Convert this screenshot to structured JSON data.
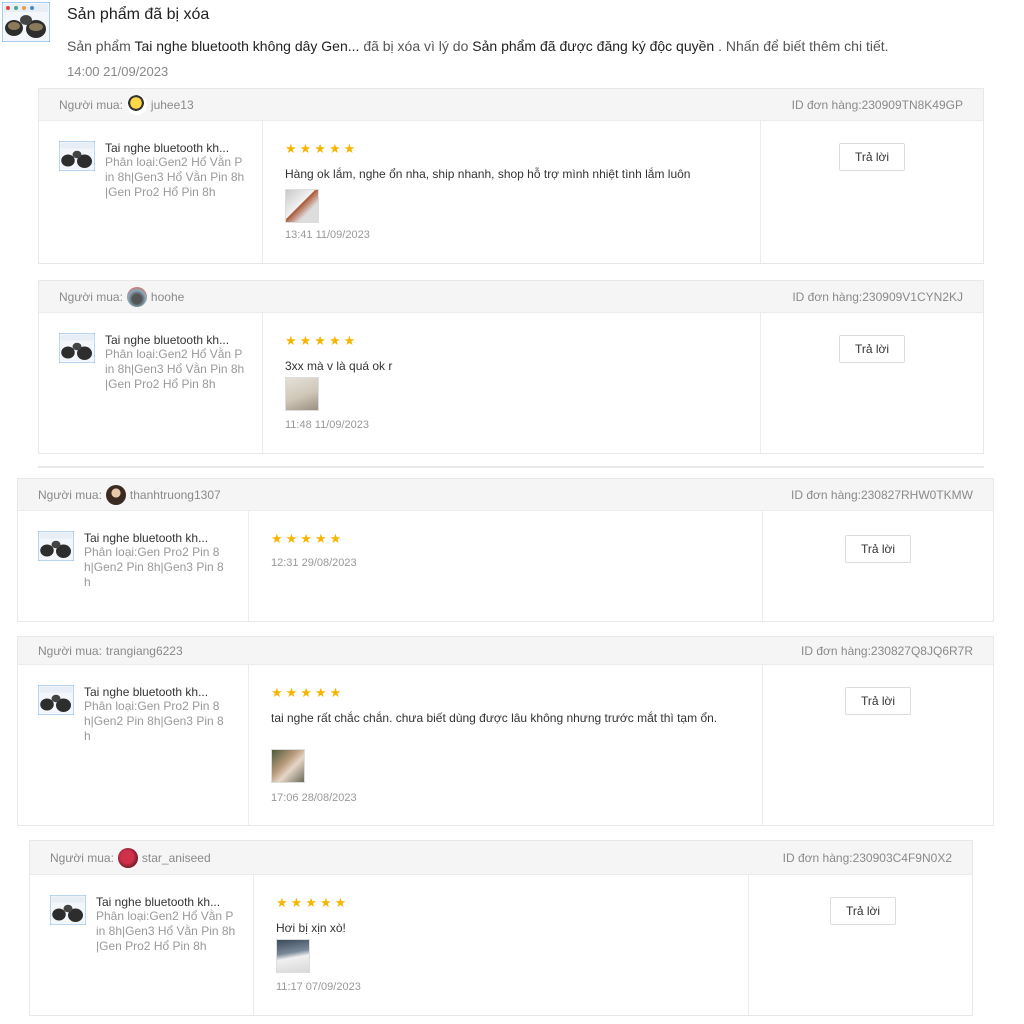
{
  "notification": {
    "title": "Sản phẩm đã bị xóa",
    "msg_prefix": "Sản phẩm",
    "product_name": "Tai nghe bluetooth không dây Gen...",
    "msg_mid": "đã bị xóa vì lý do",
    "reason": "Sản phẩm đã được đăng ký độc quyền",
    "msg_suffix": ". Nhấn để biết thêm chi tiết.",
    "time": "14:00 21/09/2023"
  },
  "reply_label": "Trả lời",
  "stars": "★★★★★",
  "reviews": [
    {
      "buyer_label": "Người mua:",
      "buyer_name": "juhee13",
      "order_id": "ID đơn hàng:230909TN8K49GP",
      "product_name": "Tai nghe bluetooth kh...",
      "variant": "Phân loại:Gen2 Hổ Vằn Pin 8h|Gen3 Hổ Vằn Pin 8h|Gen Pro2 Hổ Pin 8h",
      "text": "Hàng ok lắm, nghe ổn nha, ship nhanh, shop hỗ trợ mình nhiệt tình lắm luôn",
      "time": "13:41 11/09/2023"
    },
    {
      "buyer_label": "Người mua:",
      "buyer_name": "hoohe",
      "order_id": "ID đơn hàng:230909V1CYN2KJ",
      "product_name": "Tai nghe bluetooth kh...",
      "variant": "Phân loại:Gen2 Hổ Vằn Pin 8h|Gen3 Hổ Vằn Pin 8h|Gen Pro2 Hổ Pin 8h",
      "text": "3xx mà v là quá ok r",
      "time": "11:48 11/09/2023"
    },
    {
      "buyer_label": "Người mua:",
      "buyer_name": "thanhtruong1307",
      "order_id": "ID đơn hàng:230827RHW0TKMW",
      "product_name": "Tai nghe bluetooth kh...",
      "variant": "Phân loại:Gen Pro2 Pin 8h|Gen2 Pin 8h|Gen3 Pin 8h",
      "text": "",
      "time": "12:31 29/08/2023"
    },
    {
      "buyer_label": "Người mua:",
      "buyer_name": "trangiang6223",
      "order_id": "ID đơn hàng:230827Q8JQ6R7R",
      "product_name": "Tai nghe bluetooth kh...",
      "variant": "Phân loại:Gen Pro2 Pin 8h|Gen2 Pin 8h|Gen3 Pin 8h",
      "text": "tai nghe rất chắc chắn. chưa biết dùng được lâu không nhưng trước mắt thì tạm ổn.",
      "time": "17:06 28/08/2023"
    },
    {
      "buyer_label": "Người mua:",
      "buyer_name": "star_aniseed",
      "order_id": "ID đơn hàng:230903C4F9N0X2",
      "product_name": "Tai nghe bluetooth kh...",
      "variant": "Phân loại:Gen2 Hổ Vằn Pin 8h|Gen3 Hổ Vằn Pin 8h|Gen Pro2 Hổ Pin 8h",
      "text": "Hơi bị xịn xò!",
      "time": "11:17 07/09/2023"
    }
  ]
}
